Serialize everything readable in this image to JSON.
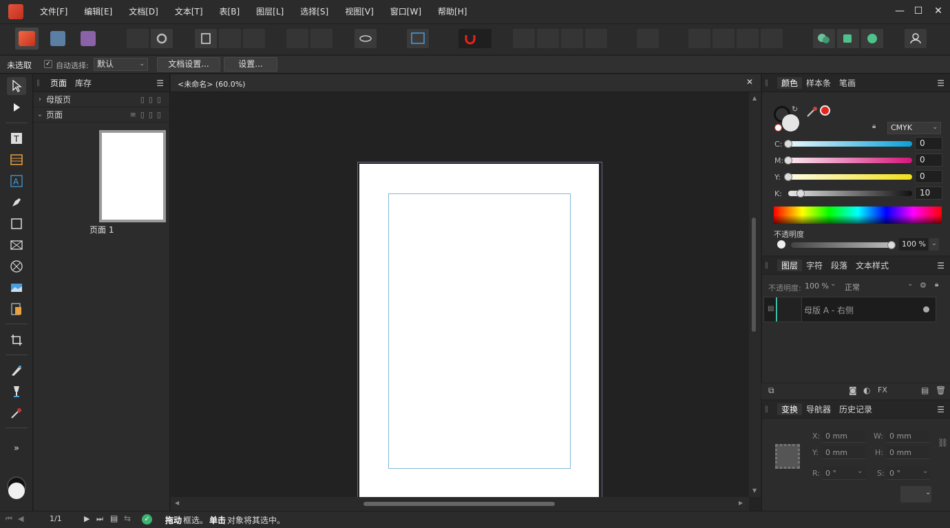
{
  "menu": [
    "文件[F]",
    "编辑[E]",
    "文档[D]",
    "文本[T]",
    "表[B]",
    "图层[L]",
    "选择[S]",
    "视图[V]",
    "窗口[W]",
    "帮助[H]"
  ],
  "window_controls": {
    "minimize": "—",
    "maximize": "☐",
    "close": "✕"
  },
  "context": {
    "selection": "未选取",
    "auto_select_label": "自动选择:",
    "auto_select_value": "默认",
    "doc_setup_label": "文档设置...",
    "settings_label": "设置..."
  },
  "pages_panel": {
    "tabs": [
      "页面",
      "库存"
    ],
    "master_section": "母版页",
    "pages_section": "页面",
    "page_label": "页面 1"
  },
  "document": {
    "tab_title": "<未命名> (60.0%)"
  },
  "color_panel": {
    "tabs": [
      "颜色",
      "样本条",
      "笔画"
    ],
    "model": "CMYK",
    "channels": [
      {
        "label": "C:",
        "value": "0",
        "level": 0
      },
      {
        "label": "M:",
        "value": "0",
        "level": 0
      },
      {
        "label": "Y:",
        "value": "0",
        "level": 0
      },
      {
        "label": "K:",
        "value": "10",
        "level": 10
      }
    ],
    "opacity_label": "不透明度",
    "opacity_value": "100 %",
    "fill_color": "#e5e5e5",
    "accent_color": "#e8231c"
  },
  "layers_panel": {
    "tabs": [
      "图层",
      "字符",
      "段落",
      "文本样式"
    ],
    "opacity_label": "不透明度:",
    "opacity_value": "100 %",
    "blend_mode": "正常",
    "layer_name": "母版 A - 右侧"
  },
  "transform_panel": {
    "tabs": [
      "变换",
      "导航器",
      "历史记录"
    ],
    "fields": {
      "x_label": "X:",
      "x": "0 mm",
      "y_label": "Y:",
      "y": "0 mm",
      "w_label": "W:",
      "w": "0 mm",
      "h_label": "H:",
      "h": "0 mm",
      "r_label": "R:",
      "r": "0 °",
      "s_label": "S:",
      "s": "0 °"
    }
  },
  "status": {
    "page_counter": "1/1",
    "hint_bold1": "拖动",
    "hint_text1": " 框选。",
    "hint_bold2": "单击",
    "hint_text2": " 对象将其选中。"
  }
}
